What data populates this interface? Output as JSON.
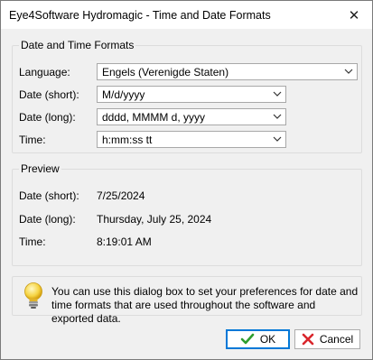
{
  "window": {
    "title": "Eye4Software Hydromagic - Time and Date Formats",
    "close_glyph": "✕"
  },
  "formats": {
    "legend": "Date and Time Formats",
    "language": {
      "label": "Language:",
      "value": "Engels (Verenigde Staten)"
    },
    "date_short": {
      "label": "Date (short):",
      "value": "M/d/yyyy"
    },
    "date_long": {
      "label": "Date (long):",
      "value": "dddd, MMMM d, yyyy"
    },
    "time": {
      "label": "Time:",
      "value": "h:mm:ss tt"
    }
  },
  "preview": {
    "legend": "Preview",
    "date_short": {
      "label": "Date (short):",
      "value": "7/25/2024"
    },
    "date_long": {
      "label": "Date (long):",
      "value": "Thursday, July 25, 2024"
    },
    "time": {
      "label": "Time:",
      "value": "8:19:01 AM"
    }
  },
  "info": {
    "icon": "lightbulb-icon",
    "text": "You can use this dialog box to set your preferences for date and time formats that are used throughout the software and exported data."
  },
  "buttons": {
    "ok": {
      "label": "OK",
      "icon": "check-icon",
      "color": "#2e9e2e"
    },
    "cancel": {
      "label": "Cancel",
      "icon": "x-icon",
      "color": "#d9262c"
    }
  },
  "colors": {
    "accent": "#0078d7"
  }
}
